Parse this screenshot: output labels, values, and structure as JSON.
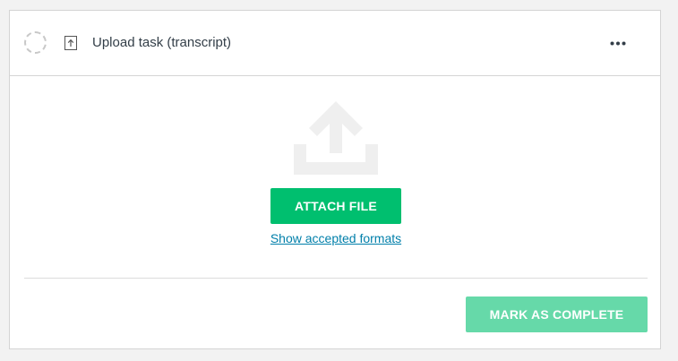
{
  "task": {
    "title": "Upload task (transcript)",
    "status": "incomplete",
    "type_icon": "upload-file-icon",
    "menu_icon": "more-horizontal-icon"
  },
  "upload": {
    "illustration_icon": "upload-arrow-icon",
    "attach_label": "ATTACH FILE",
    "formats_link": "Show accepted formats"
  },
  "footer": {
    "complete_label": "MARK AS COMPLETE"
  },
  "colors": {
    "primary_green": "#00bf6f",
    "disabled_green": "#66d9a9",
    "link_blue": "#007faa",
    "title_text": "#333e48",
    "illustration_gray": "#efefef"
  }
}
